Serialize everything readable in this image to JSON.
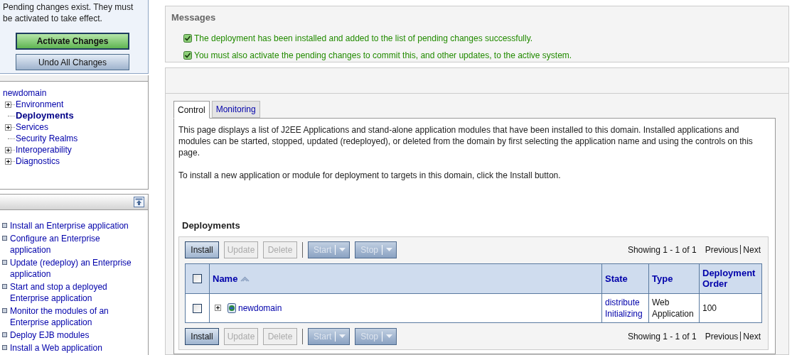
{
  "change_center": {
    "message": "Pending changes exist. They must be activated to take effect.",
    "buttons": [
      {
        "label": "Activate Changes",
        "kind": "primary"
      },
      {
        "label": "Undo All Changes",
        "kind": "secondary"
      }
    ]
  },
  "domain_tree": {
    "root": "newdomain",
    "children": [
      {
        "label": "Environment",
        "expandable": true,
        "selected": false
      },
      {
        "label": "Deployments",
        "expandable": false,
        "selected": true
      },
      {
        "label": "Services",
        "expandable": true,
        "selected": false
      },
      {
        "label": "Security Realms",
        "expandable": false,
        "selected": false
      },
      {
        "label": "Interoperability",
        "expandable": true,
        "selected": false
      },
      {
        "label": "Diagnostics",
        "expandable": true,
        "selected": false
      }
    ]
  },
  "how_do_i": {
    "items": [
      "Install an Enterprise application",
      "Configure an Enterprise application",
      "Update (redeploy) an Enterprise application",
      "Start and stop a deployed Enterprise application",
      "Monitor the modules of an Enterprise application",
      "Deploy EJB modules",
      "Install a Web application"
    ]
  },
  "messages": {
    "title": "Messages",
    "items": [
      "The deployment has been installed and added to the list of pending changes successfully.",
      "You must also activate the pending changes to commit this, and other updates, to the active system."
    ]
  },
  "tabs": [
    {
      "label": "Control",
      "selected": true
    },
    {
      "label": "Monitoring",
      "selected": false
    }
  ],
  "description": [
    "This page displays a list of J2EE Applications and stand-alone application modules that have been installed to this domain. Installed applications and modules can be started, stopped, updated (redeployed), or deleted from the domain by first selecting the application name and using the controls on this page.",
    "To install a new application or module for deployment to targets in this domain, click the Install button."
  ],
  "deployments": {
    "title": "Deployments",
    "toolbar_top": {
      "buttons": [
        {
          "label": "Install",
          "kind": "button",
          "disabled": false
        },
        {
          "label": "Update",
          "kind": "button",
          "disabled": true
        },
        {
          "label": "Delete",
          "kind": "button",
          "disabled": true
        },
        {
          "label": "Start",
          "kind": "dropdown",
          "disabled": true
        },
        {
          "label": "Stop",
          "kind": "dropdown",
          "disabled": true
        }
      ],
      "showing": "Showing 1 - 1 of 1",
      "previous": "Previous",
      "next": "Next"
    },
    "table": {
      "select_all_checked": false,
      "columns": [
        "Name",
        "State",
        "Type",
        "Deployment Order"
      ],
      "rows": [
        {
          "checked": false,
          "name": "newdomain",
          "state": "distribute Initializing",
          "type": "Web Application",
          "order": "100"
        }
      ]
    },
    "toolbar_bottom": {
      "buttons": [
        {
          "label": "Install",
          "kind": "button",
          "disabled": false
        },
        {
          "label": "Update",
          "kind": "button",
          "disabled": true
        },
        {
          "label": "Delete",
          "kind": "button",
          "disabled": true
        },
        {
          "label": "Start",
          "kind": "dropdown",
          "disabled": true
        },
        {
          "label": "Stop",
          "kind": "dropdown",
          "disabled": true
        }
      ],
      "showing": "Showing 1 - 1 of 1",
      "previous": "Previous",
      "next": "Next"
    }
  }
}
